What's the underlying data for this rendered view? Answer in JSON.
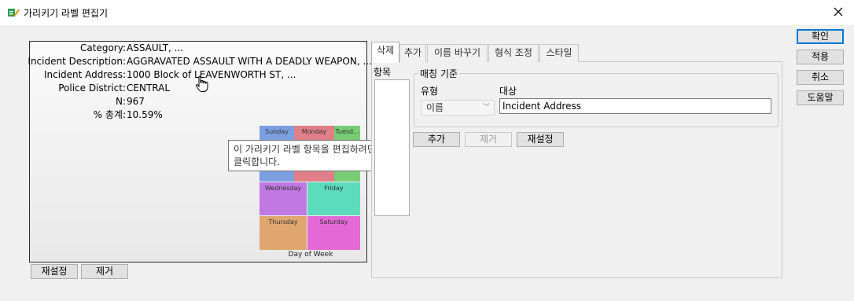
{
  "window": {
    "title": "가리키기 라벨 편집기",
    "accent": "#0078d7"
  },
  "side_buttons": {
    "ok": "확인",
    "apply": "적용",
    "cancel": "취소",
    "help": "도움말"
  },
  "preview": {
    "tooltip_rows": [
      {
        "label": "Category:",
        "value": "ASSAULT, ..."
      },
      {
        "label": "Incident Description:",
        "value": "AGGRAVATED ASSAULT WITH A DEADLY WEAPON, ..."
      },
      {
        "label": "Incident Address:",
        "value": "1000 Block of LEAVENWORTH ST, ..."
      },
      {
        "label": "Police District:",
        "value": "CENTRAL"
      },
      {
        "label": "N:",
        "value": "967"
      },
      {
        "label": "% 총계:",
        "value": "10.59%"
      }
    ],
    "hover_tip": {
      "line1": "이 가리키기 라벨 항목을 편집하려면",
      "line2": "클릭합니다."
    },
    "treemap": {
      "tiles": [
        {
          "label": "Sunday",
          "color": "#7b9fe0"
        },
        {
          "label": "Monday",
          "color": "#e07f8a"
        },
        {
          "label": "Tuesd...",
          "color": "#77cd74"
        },
        {
          "label": "Wednesday",
          "color": "#c278e3"
        },
        {
          "label": "Friday",
          "color": "#5cdcbc"
        },
        {
          "label": "Thursday",
          "color": "#e0a670"
        },
        {
          "label": "Saturday",
          "color": "#e36ad6"
        }
      ],
      "axis_label": "Day of Week"
    },
    "reset_label": "재설정",
    "remove_label": "제거"
  },
  "tabs": [
    "삭제",
    "추가",
    "이름 바꾸기",
    "형식 조정",
    "스타일"
  ],
  "editor": {
    "items_label": "항목",
    "matching_group": "매칭 기준",
    "type_label": "유형",
    "type_value": "이름",
    "target_label": "대상",
    "target_value": "Incident Address",
    "add_label": "추가",
    "remove_label": "제거",
    "reset_label": "재설정"
  }
}
